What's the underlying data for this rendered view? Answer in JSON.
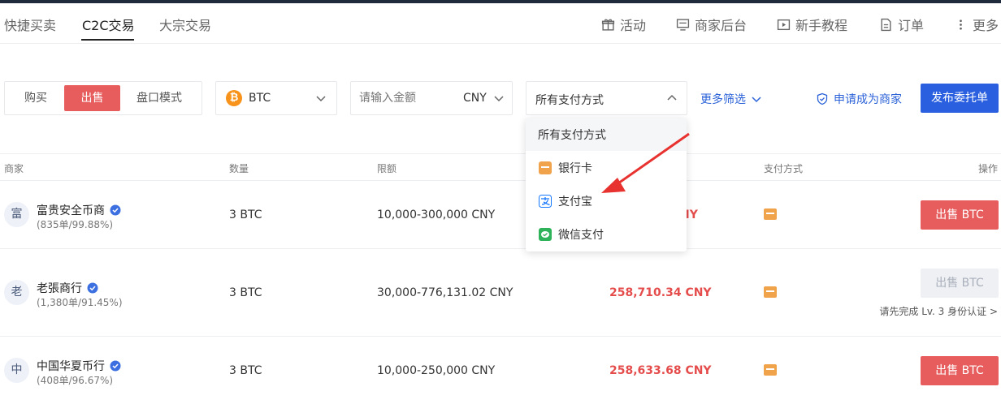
{
  "tabs": {
    "items": [
      "快捷买卖",
      "C2C交易",
      "大宗交易"
    ],
    "active_index": 1
  },
  "nav": {
    "activity": "活动",
    "merchant_backend": "商家后台",
    "tutorial": "新手教程",
    "orders": "订单",
    "more": "更多"
  },
  "segment": {
    "buy": "购买",
    "sell": "出售",
    "orderbook": "盘口模式",
    "active": "sell"
  },
  "coin": {
    "icon": "₿",
    "selected": "BTC"
  },
  "amount": {
    "placeholder": "请输入金额",
    "currency": "CNY"
  },
  "payment_select": {
    "selected": "所有支付方式",
    "open": true,
    "options": [
      {
        "label": "所有支付方式",
        "icon": ""
      },
      {
        "label": "银行卡",
        "icon": "bank-card-icon",
        "color": "#f0a34a"
      },
      {
        "label": "支付宝",
        "icon": "alipay-icon",
        "color": "#1677ff"
      },
      {
        "label": "微信支付",
        "icon": "wechat-pay-icon",
        "color": "#2fb35a"
      }
    ]
  },
  "more_filters": "更多筛选",
  "apply_merchant": "申请成为商家",
  "publish": "发布委托单",
  "table": {
    "headers": {
      "merchant": "商家",
      "quantity": "数量",
      "limit": "限额",
      "payment": "支付方式",
      "action": "操作"
    },
    "rows": [
      {
        "avatar": "富",
        "name": "富贵安全币商",
        "stats": "(835单/99.88%)",
        "quantity": "3 BTC",
        "limit": "10,000-300,000 CNY",
        "price_visible": "NY",
        "action": "出售 BTC",
        "disabled": false
      },
      {
        "avatar": "老",
        "name": "老張商行",
        "stats": "(1,380单/91.45%)",
        "quantity": "3 BTC",
        "limit": "30,000-776,131.02 CNY",
        "price": "258,710.34 CNY",
        "action": "出售 BTC",
        "disabled": true,
        "note": "请先完成 Lv. 3 身份认证 >"
      },
      {
        "avatar": "中",
        "name": "中国华夏币行",
        "stats": "(408单/96.67%)",
        "quantity": "3 BTC",
        "limit": "10,000-250,000 CNY",
        "price": "258,633.68 CNY",
        "action": "出售 BTC",
        "disabled": false
      }
    ]
  },
  "colors": {
    "sell_red": "#e75d5d",
    "primary_blue": "#2a5fe0",
    "link_blue": "#2b62d8",
    "price_red": "#e54d4d",
    "annotation_arrow": "#e8322f"
  }
}
